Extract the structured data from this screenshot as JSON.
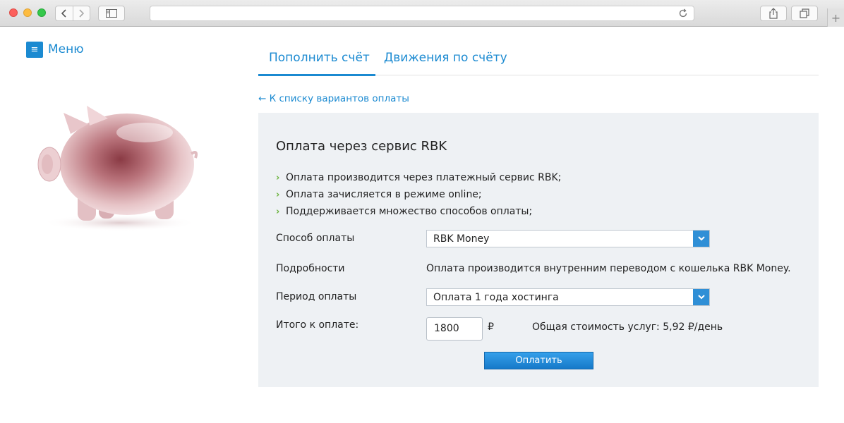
{
  "browser": {
    "back_icon": "chevron-left-icon",
    "forward_icon": "chevron-right-icon",
    "reload_icon": "reload-icon",
    "new_tab_label": "+"
  },
  "menu": {
    "label": "Меню",
    "icon_glyph": "≡"
  },
  "tabs": [
    {
      "label": "Пополнить счёт",
      "active": true
    },
    {
      "label": "Движения по счёту",
      "active": false
    }
  ],
  "back_link": "← К списку вариантов оплаты",
  "panel": {
    "title": "Оплата через сервис RBK",
    "bullets": [
      "Оплата производится через платежный сервис RBK;",
      "Оплата зачисляется в режиме online;",
      "Поддерживается множество способов оплаты;"
    ],
    "payment_method": {
      "label": "Способ оплаты",
      "value": "RBK Money"
    },
    "details": {
      "label": "Подробности",
      "value": "Оплата производится внутренним переводом с кошелька RBK Money."
    },
    "period": {
      "label": "Период оплаты",
      "value": "Оплата 1 года хостинга"
    },
    "total": {
      "label": "Итого к оплате:",
      "amount": "1800",
      "currency": "₽",
      "note": "Общая стоимость услуг: 5,92 ₽/день"
    },
    "pay_button": "Оплатить"
  },
  "colors": {
    "accent": "#1b8ad1",
    "bullet": "#6cb33f",
    "panel_bg": "#eef1f4"
  }
}
